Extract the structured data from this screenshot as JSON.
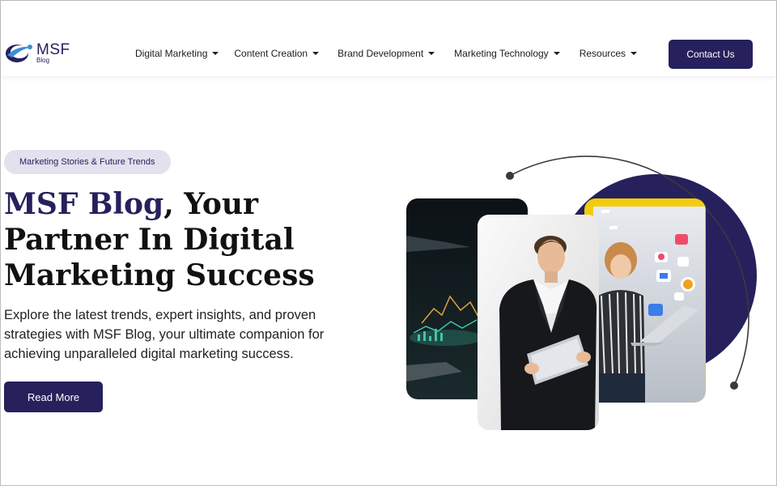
{
  "header": {
    "logo": {
      "name": "MSF",
      "sub": "Blog"
    },
    "nav": [
      {
        "label": "Digital Marketing"
      },
      {
        "label": "Content Creation"
      },
      {
        "label": "Brand Development"
      },
      {
        "label": "Marketing Technology"
      },
      {
        "label": "Resources"
      }
    ],
    "contact_label": "Contact Us"
  },
  "hero": {
    "pill": "Marketing Stories & Future Trends",
    "headline_accent": "MSF Blog",
    "headline_rest_1": ", Your",
    "headline_line_2": "Partner In Digital",
    "headline_line_3": "Marketing Success",
    "description": "Explore the latest trends, expert insights, and proven strategies with MSF Blog, your ultimate companion for achieving unparalleled digital marketing success.",
    "read_more_label": "Read More"
  },
  "colors": {
    "brand": "#26215c",
    "pill_bg": "#e4e1ef",
    "accent_yellow": "#f2cc0c"
  }
}
